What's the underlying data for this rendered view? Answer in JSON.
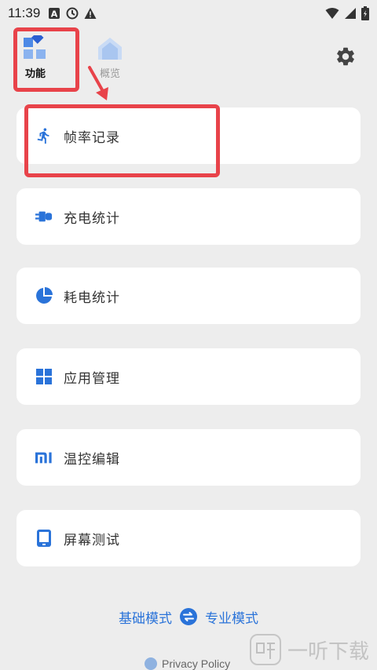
{
  "status_bar": {
    "time": "11:39",
    "icons_left": [
      "a-icon",
      "clock-icon",
      "warning-icon"
    ],
    "icons_right": [
      "wifi-icon",
      "signal-icon",
      "battery-icon"
    ]
  },
  "nav": {
    "tabs": [
      {
        "label": "功能",
        "icon": "grid-diamond-icon",
        "active": true
      },
      {
        "label": "概览",
        "icon": "home-icon",
        "active": false
      }
    ],
    "settings_icon": "gear-icon"
  },
  "menu": [
    {
      "label": "帧率记录",
      "icon": "runner-icon"
    },
    {
      "label": "充电统计",
      "icon": "plug-icon"
    },
    {
      "label": "耗电统计",
      "icon": "pie-icon"
    },
    {
      "label": "应用管理",
      "icon": "apps-icon"
    },
    {
      "label": "温控编辑",
      "icon": "mi-icon"
    },
    {
      "label": "屏幕测试",
      "icon": "phone-icon"
    }
  ],
  "mode": {
    "basic_label": "基础模式",
    "pro_label": "专业模式",
    "swap_icon": "swap-icon"
  },
  "footer": {
    "privacy_label": "Privacy Policy",
    "watermark": "一听下载"
  },
  "colors": {
    "accent": "#2a73d9",
    "highlight": "#e8434a",
    "background": "#ededed",
    "card": "#ffffff"
  }
}
